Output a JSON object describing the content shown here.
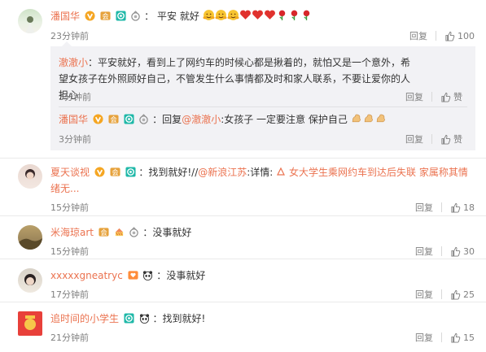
{
  "comments": [
    {
      "name": "潘国华",
      "text": "平安 就好",
      "time": "23分钟前",
      "reply_label": "回复",
      "likes": "100",
      "sub_replies": [
        {
          "name": "澈澈小",
          "text": "平安就好，看到上了网约车的时候心都是揪着的，就怕又是一个意外，希望女孩子在外照顾好自己，不管发生什么事情都及时和家人联系，不要让爱你的人担心",
          "time": "3分钟前",
          "reply_label": "回复",
          "like_label": "赞"
        },
        {
          "name": "潘国华",
          "reply_prefix": "回复",
          "mention": "@澈澈小",
          "text": ":女孩子 一定要注意 保护自己",
          "time": "3分钟前",
          "reply_label": "回复",
          "like_label": "赞"
        }
      ]
    },
    {
      "name": "夏天谈视",
      "text": "找到就好!//",
      "mention": "@新浪江苏",
      "text2": ":详情:",
      "link": "女大学生乘网约车到达后失联 家属称其情绪无...",
      "time": "15分钟前",
      "reply_label": "回复",
      "likes": "18"
    },
    {
      "name": "米海琼art",
      "text": "没事就好",
      "time": "15分钟前",
      "reply_label": "回复",
      "likes": "30"
    },
    {
      "name": "xxxxxgneatryc",
      "text": "没事就好",
      "time": "17分钟前",
      "reply_label": "回复",
      "likes": "25"
    },
    {
      "name": "追时间的小学生",
      "text": "找到就好!",
      "time": "21分钟前",
      "reply_label": "回复",
      "likes": "15"
    }
  ],
  "colors": {
    "name": "#eb7350",
    "meta": "#808080",
    "subbox": "#f2f2f5"
  }
}
